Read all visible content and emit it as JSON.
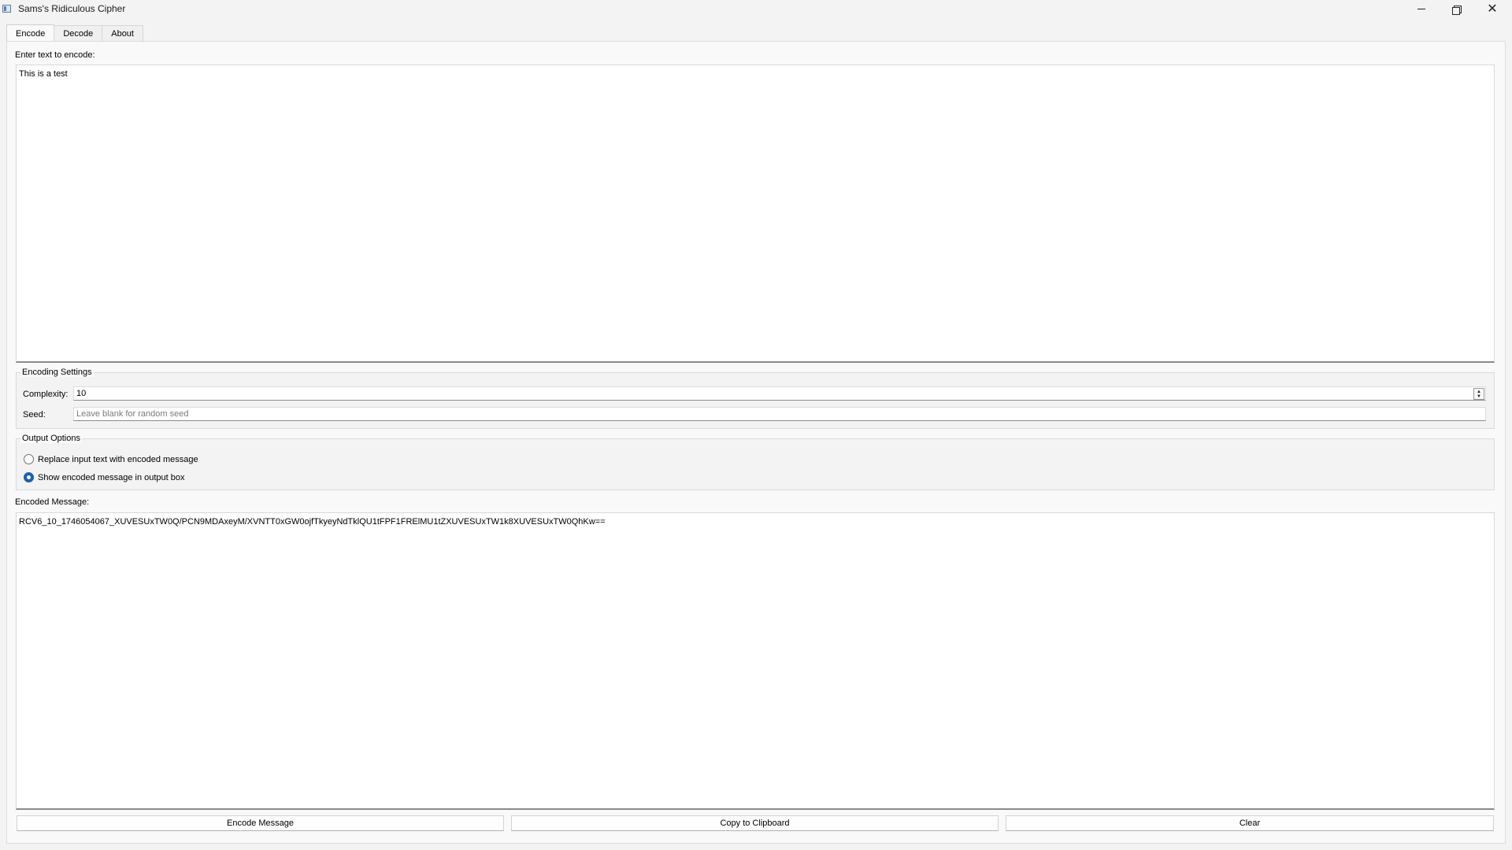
{
  "window": {
    "title": "Sams's Ridiculous Cipher"
  },
  "tabs": [
    {
      "label": "Encode",
      "active": true
    },
    {
      "label": "Decode",
      "active": false
    },
    {
      "label": "About",
      "active": false
    }
  ],
  "encode": {
    "input_label": "Enter text to encode:",
    "input_value": "This is a test",
    "settings": {
      "title": "Encoding Settings",
      "complexity_label": "Complexity:",
      "complexity_value": "10",
      "seed_label": "Seed:",
      "seed_placeholder": "Leave blank for random seed",
      "seed_value": ""
    },
    "output_options": {
      "title": "Output Options",
      "options": [
        {
          "label": "Replace input text with encoded message",
          "checked": false
        },
        {
          "label": "Show encoded message in output box",
          "checked": true
        }
      ]
    },
    "output_label": "Encoded Message:",
    "output_value": "RCV6_10_1746054067_XUVESUxTW0Q/PCN9MDAxeyM/XVNTT0xGW0ojfTkyeyNdTklQU1tFPF1FRElMU1tZXUVESUxTW1k8XUVESUxTW0QhKw==",
    "buttons": {
      "encode": "Encode Message",
      "copy": "Copy to Clipboard",
      "clear": "Clear"
    }
  },
  "colors": {
    "accent": "#1a5fb4",
    "window_bg": "#f3f3f3"
  }
}
